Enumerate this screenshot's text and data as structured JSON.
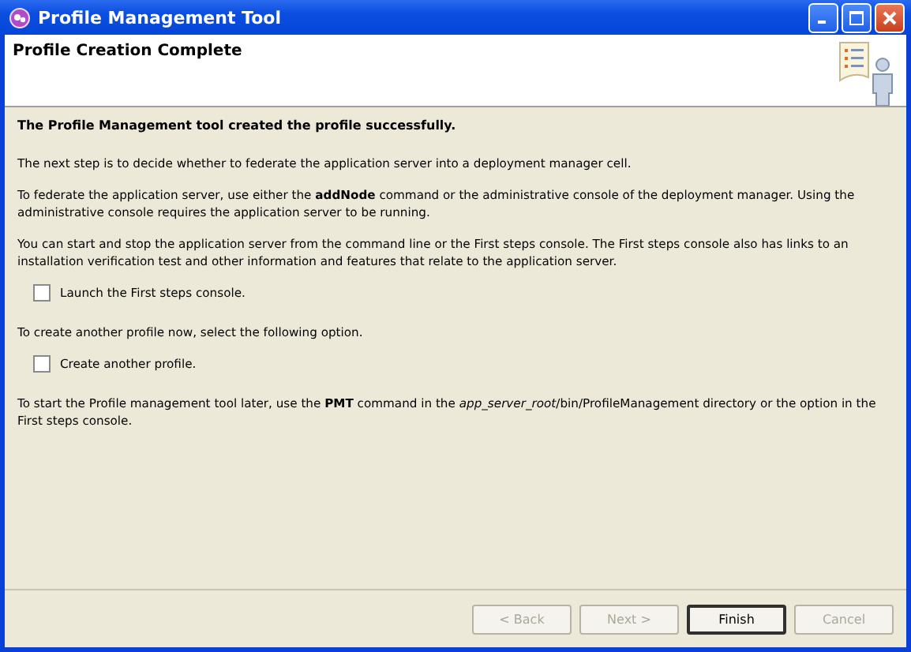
{
  "window": {
    "title": "Profile Management Tool"
  },
  "header": {
    "title": "Profile Creation Complete"
  },
  "content": [
    {
      "kind": "heading",
      "text": "The Profile Management tool created the profile successfully."
    },
    {
      "kind": "text",
      "text": "The next step is to decide whether to federate the application server into a deployment manager cell."
    },
    {
      "kind": "text",
      "text": "To federate the application server, use either the **addNode** command or the administrative console of the deployment manager. Using the administrative console requires the application server to be running."
    },
    {
      "kind": "text",
      "text": "You can start and stop the application server from the command line or the First steps console. The First steps console also has links to an installation verification test and other information and features that relate to the application server."
    },
    {
      "kind": "checkbox",
      "text": "Launch the First steps console.",
      "checked": false
    },
    {
      "kind": "text",
      "text": "To create another profile now, select the following option."
    },
    {
      "kind": "checkbox",
      "text": "Create another profile.",
      "checked": false
    },
    {
      "kind": "text",
      "text": "To start the Profile management tool later, use the **PMT** command in the *app_server_root*/bin/ProfileManagement directory or the option in the First steps console."
    }
  ],
  "buttons": [
    {
      "label": "< Back",
      "disabled": true,
      "default": false
    },
    {
      "label": "Next >",
      "disabled": true,
      "default": false
    },
    {
      "label": "Finish",
      "disabled": false,
      "default": true
    },
    {
      "label": "Cancel",
      "disabled": true,
      "default": false
    }
  ]
}
